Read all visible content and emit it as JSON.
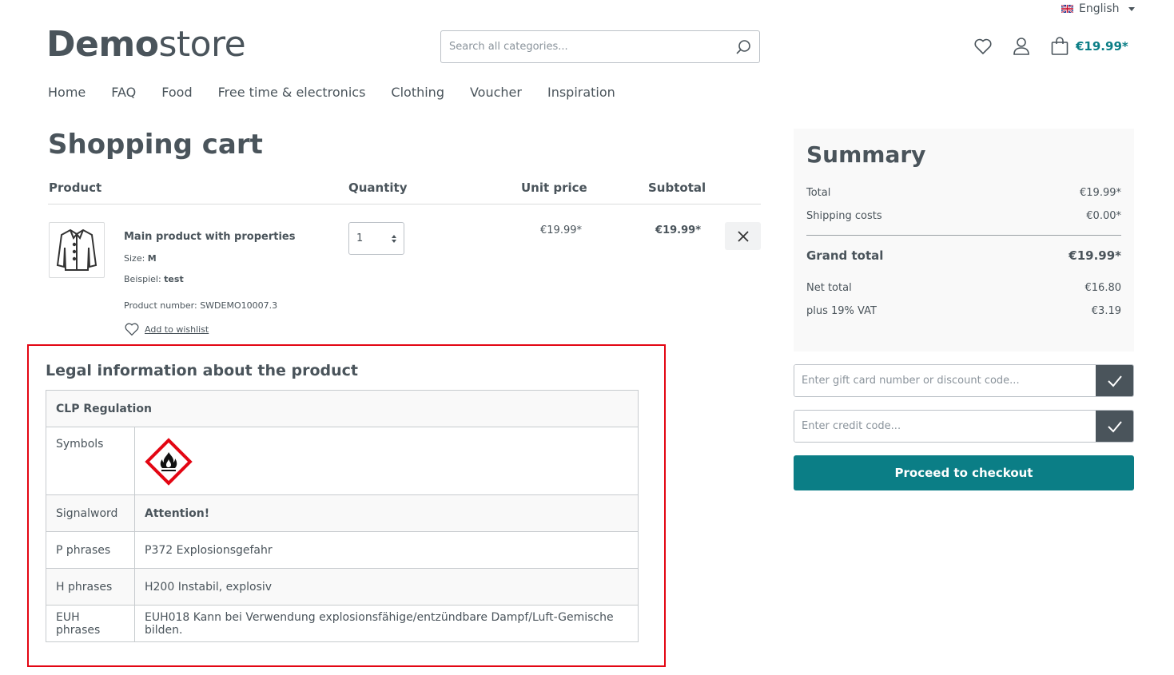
{
  "header": {
    "language": "English",
    "logo_bold": "Demo",
    "logo_light": "store",
    "search_placeholder": "Search all categories...",
    "cart_total": "€19.99*"
  },
  "nav": [
    "Home",
    "FAQ",
    "Food",
    "Free time & electronics",
    "Clothing",
    "Voucher",
    "Inspiration"
  ],
  "page": {
    "title": "Shopping cart"
  },
  "cart_table": {
    "headers": {
      "product": "Product",
      "quantity": "Quantity",
      "unit_price": "Unit price",
      "subtotal": "Subtotal"
    }
  },
  "line_item": {
    "name": "Main product with properties",
    "props": [
      {
        "label": "Size:",
        "value": "M"
      },
      {
        "label": "Beispiel:",
        "value": "test"
      }
    ],
    "product_number": "Product number: SWDEMO10007.3",
    "wishlist_label": "Add to wishlist",
    "quantity": "1",
    "unit_price": "€19.99*",
    "subtotal": "€19.99*"
  },
  "legal": {
    "title": "Legal information about the product",
    "table_header": "CLP Regulation",
    "rows": {
      "symbols": "Symbols",
      "signalword_label": "Signalword",
      "signalword_value": "Attention!",
      "p_label": "P phrases",
      "p_value": "P372 Explosionsgefahr",
      "h_label": "H phrases",
      "h_value": "H200 Instabil, explosiv",
      "euh_label": "EUH phrases",
      "euh_value": "EUH018 Kann bei Verwendung explosionsfähige/entzündbare Dampf/Luft-Gemische bilden."
    }
  },
  "summary": {
    "title": "Summary",
    "total_label": "Total",
    "total_value": "€19.99*",
    "shipping_label": "Shipping costs",
    "shipping_value": "€0.00*",
    "grand_label": "Grand total",
    "grand_value": "€19.99*",
    "net_label": "Net total",
    "net_value": "€16.80",
    "vat_label": "plus 19% VAT",
    "vat_value": "€3.19"
  },
  "codes": {
    "gift_placeholder": "Enter gift card number or discount code...",
    "credit_placeholder": "Enter credit code..."
  },
  "checkout_label": "Proceed to checkout",
  "colors": {
    "accent": "#0b7e86",
    "text": "#4a545b",
    "highlight": "#e30613"
  }
}
